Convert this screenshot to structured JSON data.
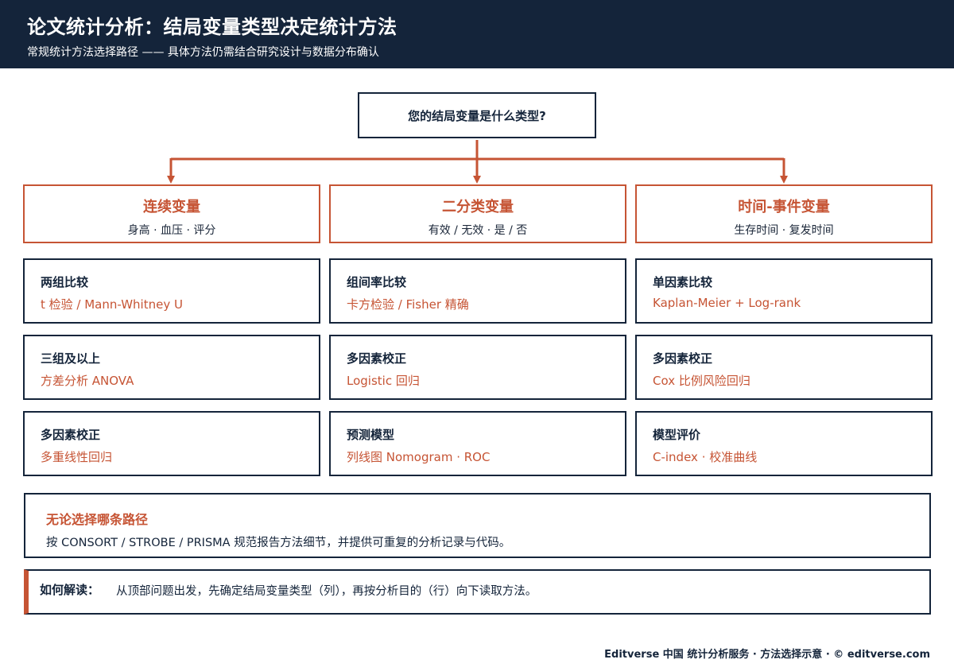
{
  "header": {
    "title": "论文统计分析：结局变量类型决定统计方法",
    "subtitle": "常规统计方法选择路径 —— 具体方法仍需结合研究设计与数据分布确认"
  },
  "root_question": "您的结局变量是什么类型?",
  "categories": [
    {
      "title": "连续变量",
      "examples": "身高 · 血压 · 评分",
      "methods": [
        {
          "label": "两组比较",
          "method": "t 检验 / Mann-Whitney U"
        },
        {
          "label": "三组及以上",
          "method": "方差分析 ANOVA"
        },
        {
          "label": "多因素校正",
          "method": "多重线性回归"
        }
      ]
    },
    {
      "title": "二分类变量",
      "examples": "有效 / 无效 · 是 / 否",
      "methods": [
        {
          "label": "组间率比较",
          "method": "卡方检验 / Fisher 精确"
        },
        {
          "label": "多因素校正",
          "method": "Logistic 回归"
        },
        {
          "label": "预测模型",
          "method": "列线图 Nomogram · ROC"
        }
      ]
    },
    {
      "title": "时间-事件变量",
      "examples": "生存时间 · 复发时间",
      "methods": [
        {
          "label": "单因素比较",
          "method": "Kaplan-Meier + Log-rank"
        },
        {
          "label": "多因素校正",
          "method": "Cox 比例风险回归"
        },
        {
          "label": "模型评价",
          "method": "C-index · 校准曲线"
        }
      ]
    }
  ],
  "note": {
    "title": "无论选择哪条路径",
    "body": "按 CONSORT / STROBE / PRISMA 规范报告方法细节，并提供可重复的分析记录与代码。"
  },
  "howto": {
    "label": "如何解读：",
    "text": "从顶部问题出发，先确定结局变量类型（列），再按分析目的（行）向下读取方法。"
  },
  "footer": "Editverse 中国 统计分析服务 · 方法选择示意 · © editverse.com",
  "colors": {
    "navy": "#14243a",
    "accent": "#c65434"
  }
}
